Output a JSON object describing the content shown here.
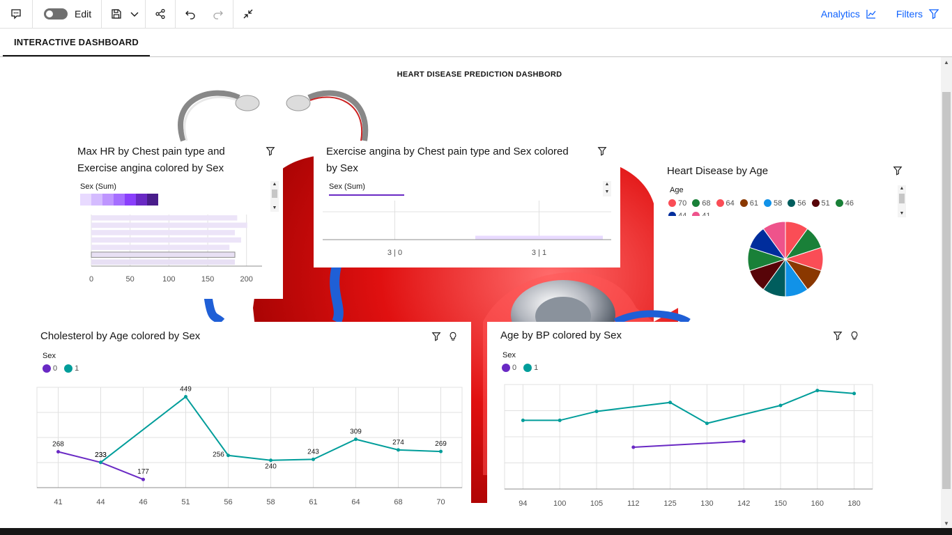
{
  "toolbar": {
    "edit_label": "Edit",
    "analytics_label": "Analytics",
    "filters_label": "Filters"
  },
  "tabs": [
    {
      "label": "INTERACTIVE DASHBOARD"
    }
  ],
  "dashboard": {
    "title": "HEART DISEASE PREDICTION DASHBORD"
  },
  "colors": {
    "accent": "#0f62fe",
    "purple": "#6929c4",
    "teal": "#1192e8",
    "teal_line": "#009d9a"
  },
  "tiles": {
    "maxhr": {
      "title_line1": "Max HR by Chest pain type and",
      "title_line2": "Exercise angina colored by Sex",
      "legend_label": "Sex (Sum)"
    },
    "exang": {
      "title_line1": "Exercise angina by Chest pain type and Sex colored",
      "title_line2": "by Sex",
      "legend_label": "Sex (Sum)"
    },
    "hdage": {
      "title": "Heart Disease by Age",
      "legend_label": "Age"
    },
    "chol": {
      "title": "Cholesterol by Age colored by Sex",
      "legend_label": "Sex"
    },
    "bp": {
      "title": "Age by BP colored by Sex",
      "legend_label": "Sex"
    }
  },
  "chart_data": [
    {
      "type": "bar",
      "title": "Max HR by Chest pain type and Exercise angina colored by Sex",
      "orientation": "horizontal",
      "legend_title": "Sex (Sum)",
      "values": [
        188,
        201,
        185,
        193,
        178,
        185,
        185
      ],
      "xlim": [
        0,
        220
      ],
      "xticks": [
        0,
        50,
        100,
        150,
        200
      ]
    },
    {
      "type": "bar",
      "title": "Exercise angina by Chest pain type and Sex colored by Sex",
      "legend_title": "Sex (Sum)",
      "categories": [
        "3 | 0",
        "3 | 1"
      ],
      "values": [
        0.05,
        1
      ],
      "ylim": [
        0,
        10
      ]
    },
    {
      "type": "pie",
      "title": "Heart Disease by Age",
      "legend_title": "Age",
      "legend": [
        {
          "label": "70",
          "color": "#fa4d56"
        },
        {
          "label": "68",
          "color": "#198038"
        },
        {
          "label": "64",
          "color": "#fa4d56"
        },
        {
          "label": "61",
          "color": "#8a3800"
        },
        {
          "label": "58",
          "color": "#1192e8"
        },
        {
          "label": "56",
          "color": "#005d5d"
        },
        {
          "label": "51",
          "color": "#570408"
        },
        {
          "label": "46",
          "color": "#198038"
        },
        {
          "label": "44",
          "color": "#002d9c"
        },
        {
          "label": "41",
          "color": "#ee538b"
        }
      ],
      "slice_colors": [
        "#fa4d56",
        "#198038",
        "#fa4d56",
        "#8a3800",
        "#1192e8",
        "#005d5d",
        "#570408",
        "#198038",
        "#002d9c",
        "#ee538b"
      ],
      "values": [
        1,
        1,
        1,
        1,
        1,
        1,
        1,
        1,
        1,
        1
      ]
    },
    {
      "type": "line",
      "title": "Cholesterol by Age colored by Sex",
      "legend_title": "Sex",
      "categories": [
        "41",
        "44",
        "46",
        "51",
        "56",
        "58",
        "61",
        "64",
        "68",
        "70"
      ],
      "ylim": [
        150,
        480
      ],
      "series": [
        {
          "name": "0",
          "color": "#6929c4",
          "points": [
            {
              "x": "41",
              "y": 268
            },
            {
              "x": "44",
              "y": 233
            },
            {
              "x": "46",
              "y": 177
            }
          ]
        },
        {
          "name": "1",
          "color": "#009d9a",
          "points": [
            {
              "x": "44",
              "y": 233
            },
            {
              "x": "51",
              "y": 449
            },
            {
              "x": "56",
              "y": 256
            },
            {
              "x": "58",
              "y": 240
            },
            {
              "x": "61",
              "y": 243
            },
            {
              "x": "64",
              "y": 309
            },
            {
              "x": "68",
              "y": 274
            },
            {
              "x": "70",
              "y": 269
            }
          ]
        }
      ]
    },
    {
      "type": "line",
      "title": "Age by BP colored by Sex",
      "legend_title": "Sex",
      "categories": [
        "94",
        "100",
        "105",
        "112",
        "125",
        "130",
        "142",
        "150",
        "160",
        "180"
      ],
      "ylim": [
        40,
        75
      ],
      "series": [
        {
          "name": "0",
          "color": "#6929c4",
          "points": [
            {
              "x": "112",
              "y": 54
            },
            {
              "x": "142",
              "y": 56
            }
          ]
        },
        {
          "name": "1",
          "color": "#009d9a",
          "points": [
            {
              "x": "94",
              "y": 63
            },
            {
              "x": "100",
              "y": 63
            },
            {
              "x": "105",
              "y": 66
            },
            {
              "x": "125",
              "y": 69
            },
            {
              "x": "130",
              "y": 62
            },
            {
              "x": "150",
              "y": 68
            },
            {
              "x": "160",
              "y": 73
            },
            {
              "x": "180",
              "y": 72
            }
          ]
        }
      ]
    }
  ]
}
